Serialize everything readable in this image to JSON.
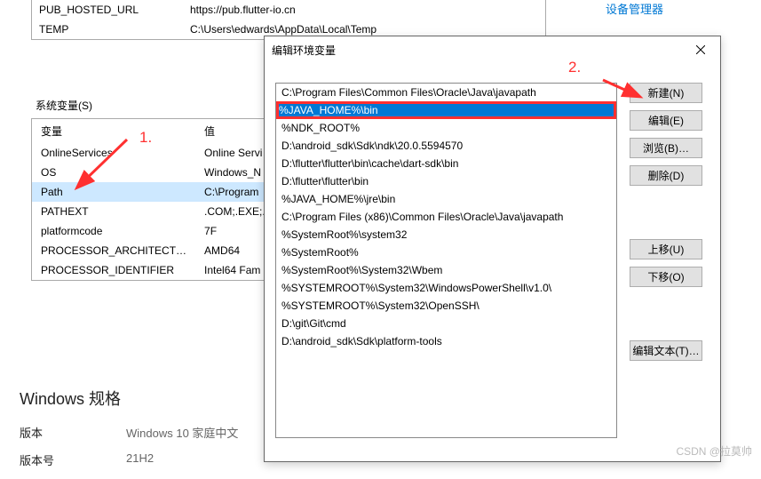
{
  "user_vars": [
    {
      "name": "PUB_HOSTED_URL",
      "value": "https://pub.flutter-io.cn"
    },
    {
      "name": "TEMP",
      "value": "C:\\Users\\edwards\\AppData\\Local\\Temp"
    }
  ],
  "top_links": {
    "device_manager": "设备管理器",
    "partial": ""
  },
  "sys_vars_label": "系统变量(S)",
  "sys_vars_headers": {
    "name": "变量",
    "value": "值"
  },
  "sys_vars": [
    {
      "name": "OnlineServices",
      "value": "Online Servi"
    },
    {
      "name": "OS",
      "value": "Windows_N"
    },
    {
      "name": "Path",
      "value": "C:\\Program",
      "selected": true
    },
    {
      "name": "PATHEXT",
      "value": ".COM;.EXE;."
    },
    {
      "name": "platformcode",
      "value": "7F"
    },
    {
      "name": "PROCESSOR_ARCHITECT…",
      "value": "AMD64"
    },
    {
      "name": "PROCESSOR_IDENTIFIER",
      "value": "Intel64 Fam"
    }
  ],
  "win_spec": {
    "title": "Windows 规格",
    "rows": [
      {
        "label": "版本",
        "value": "Windows 10 家庭中文"
      },
      {
        "label": "版本号",
        "value": "21H2"
      }
    ]
  },
  "edit_dialog": {
    "title": "编辑环境变量",
    "items": [
      {
        "text": "C:\\Program Files\\Common Files\\Oracle\\Java\\javapath"
      },
      {
        "text": "%JAVA_HOME%\\bin",
        "highlighted": true,
        "redbox": true
      },
      {
        "text": "%NDK_ROOT%"
      },
      {
        "text": "D:\\android_sdk\\Sdk\\ndk\\20.0.5594570"
      },
      {
        "text": "D:\\flutter\\flutter\\bin\\cache\\dart-sdk\\bin"
      },
      {
        "text": "D:\\flutter\\flutter\\bin"
      },
      {
        "text": "%JAVA_HOME%\\jre\\bin"
      },
      {
        "text": "C:\\Program Files (x86)\\Common Files\\Oracle\\Java\\javapath"
      },
      {
        "text": "%SystemRoot%\\system32"
      },
      {
        "text": "%SystemRoot%"
      },
      {
        "text": "%SystemRoot%\\System32\\Wbem"
      },
      {
        "text": "%SYSTEMROOT%\\System32\\WindowsPowerShell\\v1.0\\"
      },
      {
        "text": "%SYSTEMROOT%\\System32\\OpenSSH\\"
      },
      {
        "text": "D:\\git\\Git\\cmd"
      },
      {
        "text": "D:\\android_sdk\\Sdk\\platform-tools"
      }
    ],
    "buttons": {
      "new": "新建(N)",
      "edit": "编辑(E)",
      "browse": "浏览(B)…",
      "delete": "删除(D)",
      "move_up": "上移(U)",
      "move_down": "下移(O)",
      "edit_text": "编辑文本(T)…"
    }
  },
  "annotations": {
    "label1": "1.",
    "label2": "2."
  },
  "watermark": "CSDN @拉莫帅"
}
